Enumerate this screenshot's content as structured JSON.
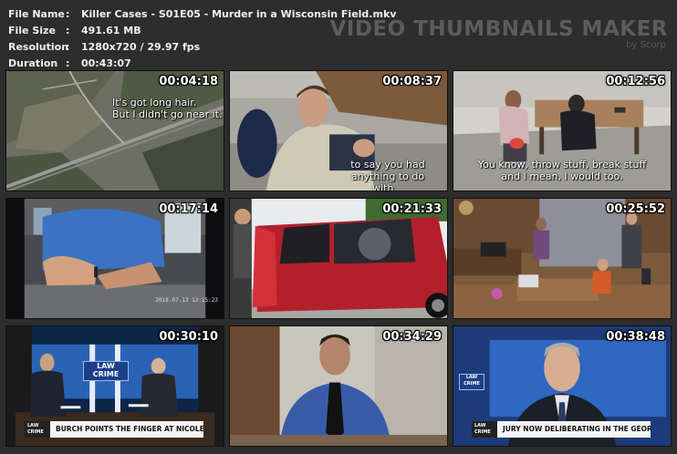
{
  "file_info": {
    "rows": [
      {
        "key": "File Name",
        "value": "Killer Cases - S01E05 - Murder in a Wisconsin Field.mkv"
      },
      {
        "key": "File Size",
        "value": "491.61 MB"
      },
      {
        "key": "Resolution",
        "value": "1280x720 / 29.97 fps"
      },
      {
        "key": "Duration",
        "value": "00:43:07"
      }
    ],
    "separator": ":"
  },
  "brand": {
    "title": "VIDEO THUMBNAILS MAKER",
    "subtitle": "by Scorp"
  },
  "thumbnails": [
    {
      "timestamp": "00:04:18",
      "caption": [
        "It's got long hair.",
        "But I didn't go near it."
      ]
    },
    {
      "timestamp": "00:08:37",
      "caption": [
        "to say you had",
        "anything to do with..."
      ]
    },
    {
      "timestamp": "00:12:56",
      "caption": [
        "You know, throw stuff, break stuff",
        "and I mean, I would too."
      ]
    },
    {
      "timestamp": "00:17:14",
      "caption": [],
      "corner_text": "2018.07.13 12:15:23"
    },
    {
      "timestamp": "00:21:33",
      "caption": []
    },
    {
      "timestamp": "00:25:52",
      "caption": []
    },
    {
      "timestamp": "00:30:10",
      "caption": [],
      "logo": [
        "LAW",
        "CRIME"
      ],
      "lower_third": "BURCH POINTS THE FINGER AT NICOLE'S BOYFRIEND",
      "bug": [
        "LAW",
        "CRIME"
      ]
    },
    {
      "timestamp": "00:34:29",
      "caption": []
    },
    {
      "timestamp": "00:38:48",
      "caption": [],
      "logo": [
        "LAW",
        "CRIME"
      ],
      "lower_third": "JURY NOW DELIBERATING IN THE GEORGE BURCH TRIAL",
      "bug": [
        "LAW",
        "CRIME"
      ]
    }
  ],
  "colors": {
    "background": "#2d2d2d",
    "text": "#f0f0f0",
    "brand": "#5c5c5c"
  }
}
